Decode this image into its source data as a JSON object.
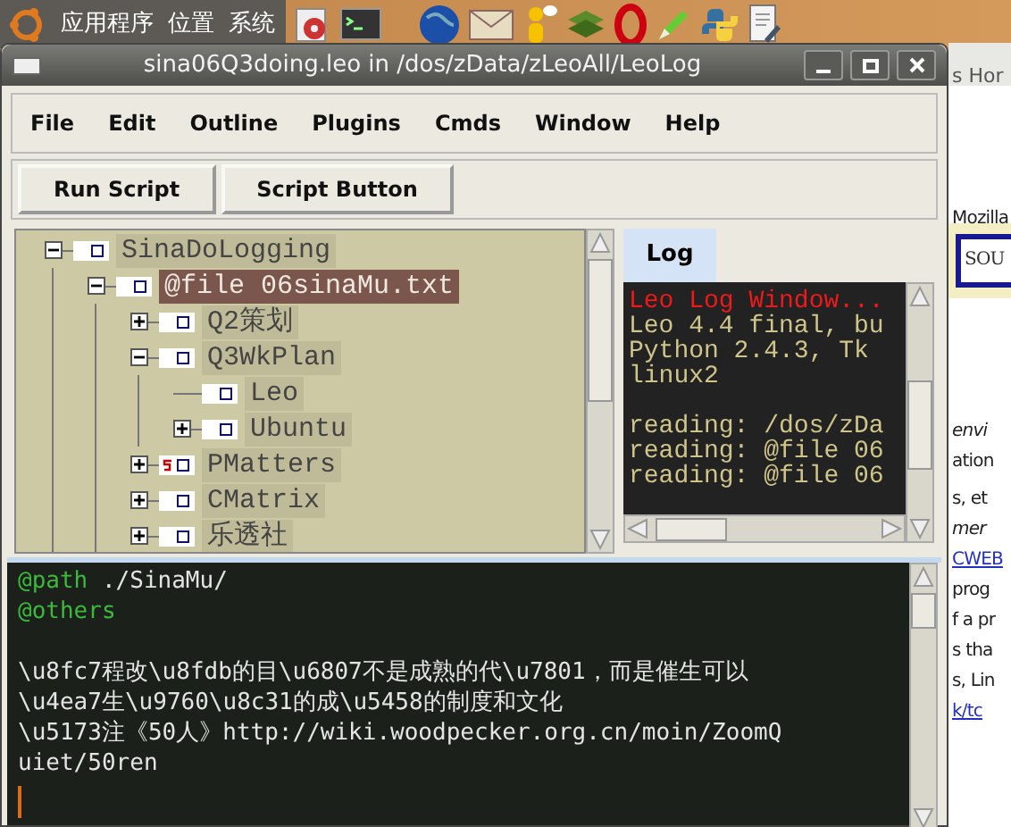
{
  "top_panel": {
    "menus": [
      "应用程序",
      "位置",
      "系统"
    ]
  },
  "window": {
    "title": "sina06Q3doing.leo in /dos/zData/zLeoAll/LeoLog"
  },
  "menu_bar": [
    "File",
    "Edit",
    "Outline",
    "Plugins",
    "Cmds",
    "Window",
    "Help"
  ],
  "toolbar": [
    "Run Script",
    "Script Button"
  ],
  "outline": [
    {
      "label": "SinaDoLogging",
      "has_children": true,
      "expanded": true,
      "selected": false,
      "marked": false,
      "children": [
        {
          "label": "@file 06sinaMu.txt",
          "has_children": true,
          "expanded": true,
          "selected": true,
          "marked": false,
          "children": [
            {
              "label": "Q2策划",
              "has_children": true,
              "expanded": false,
              "selected": false,
              "marked": false
            },
            {
              "label": "Q3WkPlan",
              "has_children": true,
              "expanded": true,
              "selected": false,
              "marked": false,
              "children": [
                {
                  "label": "Leo",
                  "has_children": false,
                  "selected": false,
                  "marked": false
                },
                {
                  "label": "Ubuntu",
                  "has_children": true,
                  "expanded": false,
                  "selected": false,
                  "marked": false
                }
              ]
            },
            {
              "label": "PMatters",
              "has_children": true,
              "expanded": false,
              "selected": false,
              "marked": true
            },
            {
              "label": "CMatrix",
              "has_children": true,
              "expanded": false,
              "selected": false,
              "marked": false
            },
            {
              "label": "乐透社",
              "has_children": true,
              "expanded": false,
              "selected": false,
              "marked": false
            }
          ]
        }
      ]
    }
  ],
  "log": {
    "tab": {
      "label": "Log",
      "selected": true
    },
    "lines": [
      {
        "text": "Leo Log Window...",
        "kind": "error"
      },
      {
        "text": "Leo 4.4 final, bu",
        "kind": "info"
      },
      {
        "text": "Python 2.4.3, Tk",
        "kind": "info"
      },
      {
        "text": "linux2",
        "kind": "info"
      },
      {
        "kind": "blank"
      },
      {
        "text": "reading: /dos/zDa",
        "kind": "info"
      },
      {
        "text": "reading: @file 06",
        "kind": "info"
      },
      {
        "text": "reading: @file 06",
        "kind": "info"
      }
    ]
  },
  "body": {
    "lines": [
      {
        "kind": "code",
        "directive": "@path",
        "text": " ./SinaMu/"
      },
      {
        "kind": "code",
        "directive": "@others"
      },
      {
        "kind": "blank"
      },
      {
        "kind": "code",
        "text": "\\u8fc7程改\\u8fdb的目\\u6807不是成熟的代\\u7801，而是催生可以"
      },
      {
        "kind": "code",
        "text": "\\u4ea7生\\u9760\\u8c31的成\\u5458的制度和文化"
      },
      {
        "kind": "code",
        "text": "\\u5173注《50人》http://wiki.woodpecker.org.cn/moin/ZoomQ"
      },
      {
        "kind": "code",
        "text": "uiet/50ren"
      }
    ]
  },
  "background_window": {
    "title": "s Hor",
    "lines": [
      {
        "text": "Mozilla",
        "kind": "text"
      },
      {
        "text": "SOU",
        "kind": "banner"
      },
      {
        "text": "envi",
        "kind": "italic"
      },
      {
        "text": "ation",
        "kind": "text"
      },
      {
        "text": "s, et",
        "kind": "text"
      },
      {
        "text": "mer",
        "kind": "italic"
      },
      {
        "text": "CWEB",
        "kind": "link"
      },
      {
        "text": "prog",
        "kind": "text"
      },
      {
        "text": "f a pr",
        "kind": "text"
      },
      {
        "text": "s tha",
        "kind": "text"
      },
      {
        "text": "s, Lin",
        "kind": "text"
      },
      {
        "text": "k/tc",
        "kind": "link"
      }
    ]
  }
}
